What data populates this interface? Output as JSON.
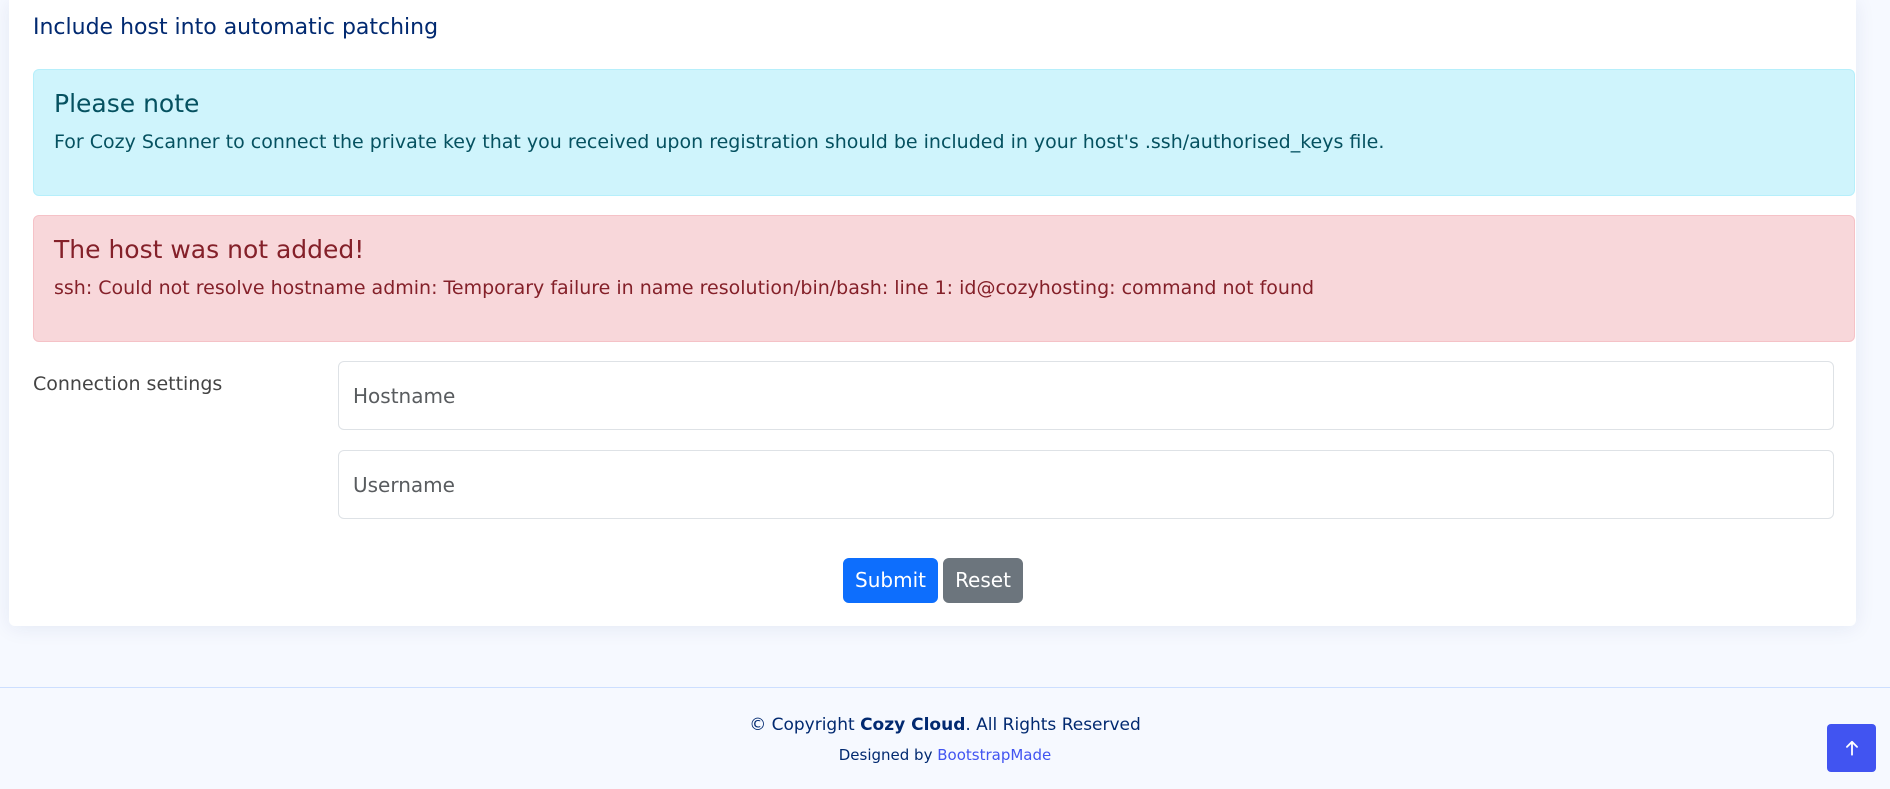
{
  "card": {
    "title": "Include host into automatic patching"
  },
  "info_alert": {
    "heading": "Please note",
    "text": "For Cozy Scanner to connect the private key that you received upon registration should be included in your host's .ssh/authorised_keys file."
  },
  "error_alert": {
    "heading": "The host was not added!",
    "text": "ssh: Could not resolve hostname admin: Temporary failure in name resolution/bin/bash: line 1: id@cozyhosting: command not found"
  },
  "form": {
    "section_label": "Connection settings",
    "hostname": {
      "value": "",
      "placeholder": "Hostname"
    },
    "username": {
      "value": "",
      "placeholder": "Username"
    },
    "submit_label": "Submit",
    "reset_label": "Reset"
  },
  "footer": {
    "copyright_prefix": "© Copyright ",
    "company": "Cozy Cloud",
    "copyright_suffix": ". All Rights Reserved",
    "credits_prefix": "Designed by ",
    "credits_link": "BootstrapMade"
  },
  "back_to_top": {
    "icon": "arrow-up-icon"
  },
  "colors": {
    "primary": "#0d6efd",
    "secondary": "#6c757d",
    "info_bg": "#cff4fc",
    "danger_bg": "#f8d7da",
    "brand": "#4154f1",
    "heading": "#012970"
  }
}
